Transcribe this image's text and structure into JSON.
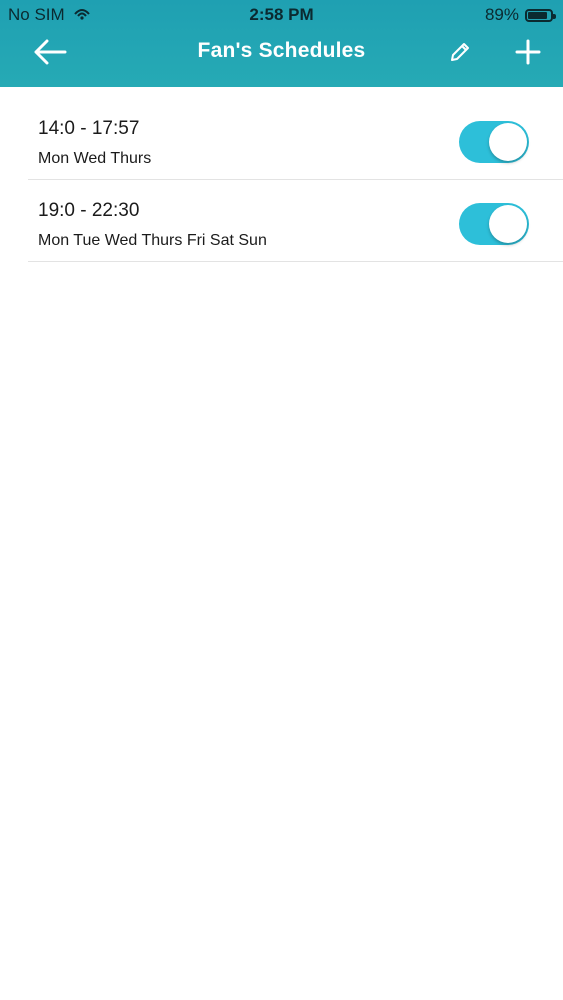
{
  "status_bar": {
    "carrier": "No SIM",
    "time": "2:58 PM",
    "battery_percent_label": "89%",
    "battery_level": 0.89,
    "icons": [
      "wifi-icon",
      "battery-icon"
    ]
  },
  "nav": {
    "title": "Fan's Schedules",
    "back_icon": "arrow-left-icon",
    "edit_icon": "pencil-icon",
    "add_icon": "plus-icon"
  },
  "colors": {
    "header": "#22a4b4",
    "toggle_on": "#2dbfd9"
  },
  "schedules": [
    {
      "time_range": "14:0 - 17:57",
      "days": "Mon Wed Thurs",
      "enabled": true
    },
    {
      "time_range": "19:0 - 22:30",
      "days": "Mon Tue Wed Thurs Fri Sat Sun",
      "enabled": true
    }
  ]
}
